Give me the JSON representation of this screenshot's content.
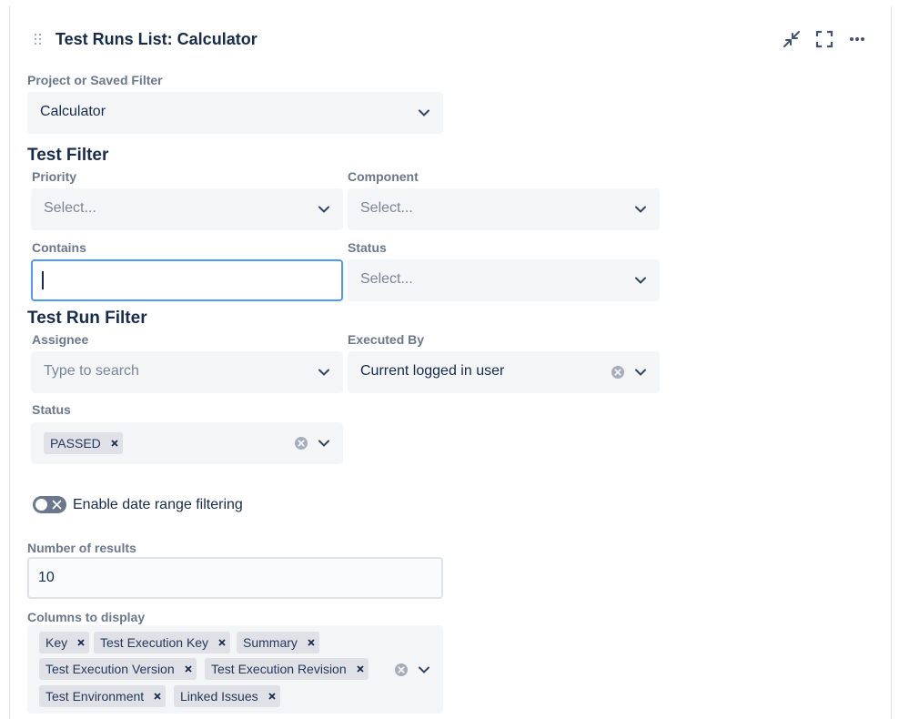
{
  "widget": {
    "title": "Test Runs List: Calculator",
    "header_buttons": [
      "minimize-icon",
      "fullscreen-icon",
      "more-icon"
    ],
    "accent_color": "#2f80ed"
  },
  "project": {
    "label": "Project or Saved Filter",
    "value": "Calculator"
  },
  "test_filter": {
    "heading": "Test Filter",
    "priority": {
      "label": "Priority",
      "placeholder": "Select..."
    },
    "component": {
      "label": "Component",
      "placeholder": "Select..."
    },
    "contains": {
      "label": "Contains",
      "value": ""
    },
    "status": {
      "label": "Status",
      "placeholder": "Select..."
    }
  },
  "test_run_filter": {
    "heading": "Test Run Filter",
    "assignee": {
      "label": "Assignee",
      "placeholder": "Type to search"
    },
    "executed_by": {
      "label": "Executed By",
      "value": "Current logged in user"
    },
    "status": {
      "label": "Status",
      "tags": [
        "PASSED"
      ]
    }
  },
  "date_range": {
    "label": "Enable date range filtering",
    "enabled": false
  },
  "results": {
    "label": "Number of results",
    "value": "10"
  },
  "columns": {
    "label": "Columns to display",
    "tags": [
      "Key",
      "Test Execution Key",
      "Summary",
      "Test Execution Version",
      "Test Execution Revision",
      "Test Environment",
      "Linked Issues"
    ]
  }
}
